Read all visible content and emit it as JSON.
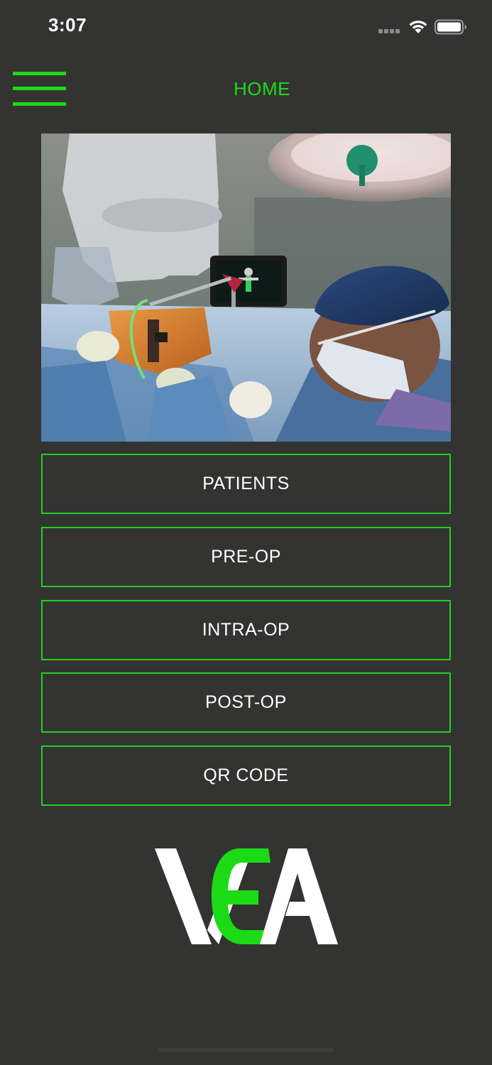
{
  "status_bar": {
    "time": "3:07"
  },
  "header": {
    "title": "HOME",
    "menu_icon": "hamburger-menu-icon"
  },
  "hero": {
    "alt": "surgeon-operating-room-photo"
  },
  "nav": {
    "patients": "PATIENTS",
    "pre_op": "PRE-OP",
    "intra_op": "INTRA-OP",
    "post_op": "POST-OP",
    "qr_code": "QR CODE"
  },
  "logo": {
    "text": "VEA"
  },
  "colors": {
    "background": "#333432",
    "accent": "#1bdb17",
    "text": "#ffffff"
  }
}
